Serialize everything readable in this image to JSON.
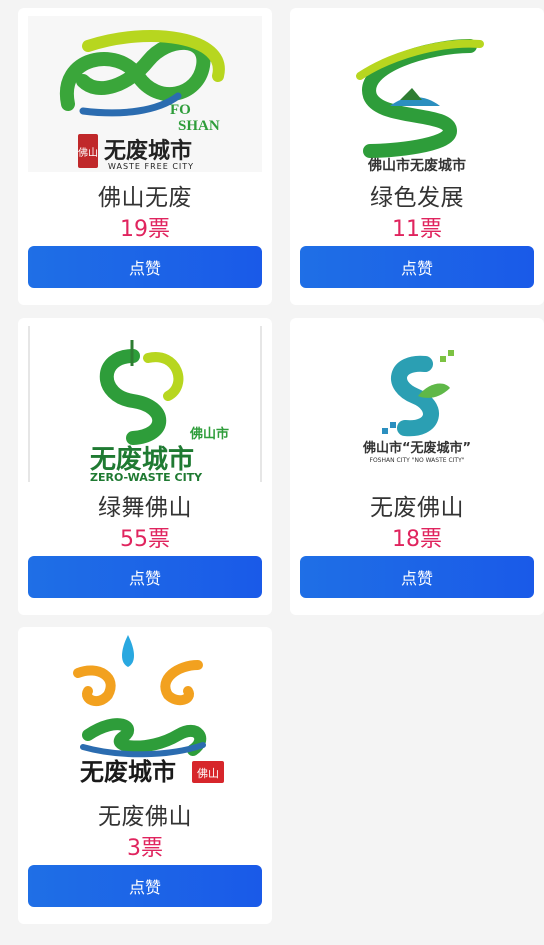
{
  "cards": [
    {
      "name": "佛山无废",
      "votes": "19票",
      "button": "点赞",
      "logo": {
        "line1": "FO",
        "line2": "SHAN",
        "title": "无废城市",
        "sub": "WASTE FREE CITY",
        "seal": "佛山"
      }
    },
    {
      "name": "绿色发展",
      "votes": "11票",
      "button": "点赞",
      "logo": {
        "title": "佛山市无废城市"
      }
    },
    {
      "name": "绿舞佛山",
      "votes": "55票",
      "button": "点赞",
      "logo": {
        "small": "佛山市",
        "title": "无废城市",
        "sub": "ZERO-WASTE CITY"
      }
    },
    {
      "name": "无废佛山",
      "votes": "18票",
      "button": "点赞",
      "logo": {
        "title": "佛山市“无废城市”",
        "sub": "FOSHAN CITY \"NO WASTE CITY\""
      }
    },
    {
      "name": "无废佛山",
      "votes": "3票",
      "button": "点赞",
      "logo": {
        "title": "无废城市",
        "seal": "佛山"
      }
    }
  ],
  "colors": {
    "accent": "#1a5ae8",
    "votes": "#e0245e",
    "green": "#2e9d3a",
    "lime": "#b7d61f"
  }
}
